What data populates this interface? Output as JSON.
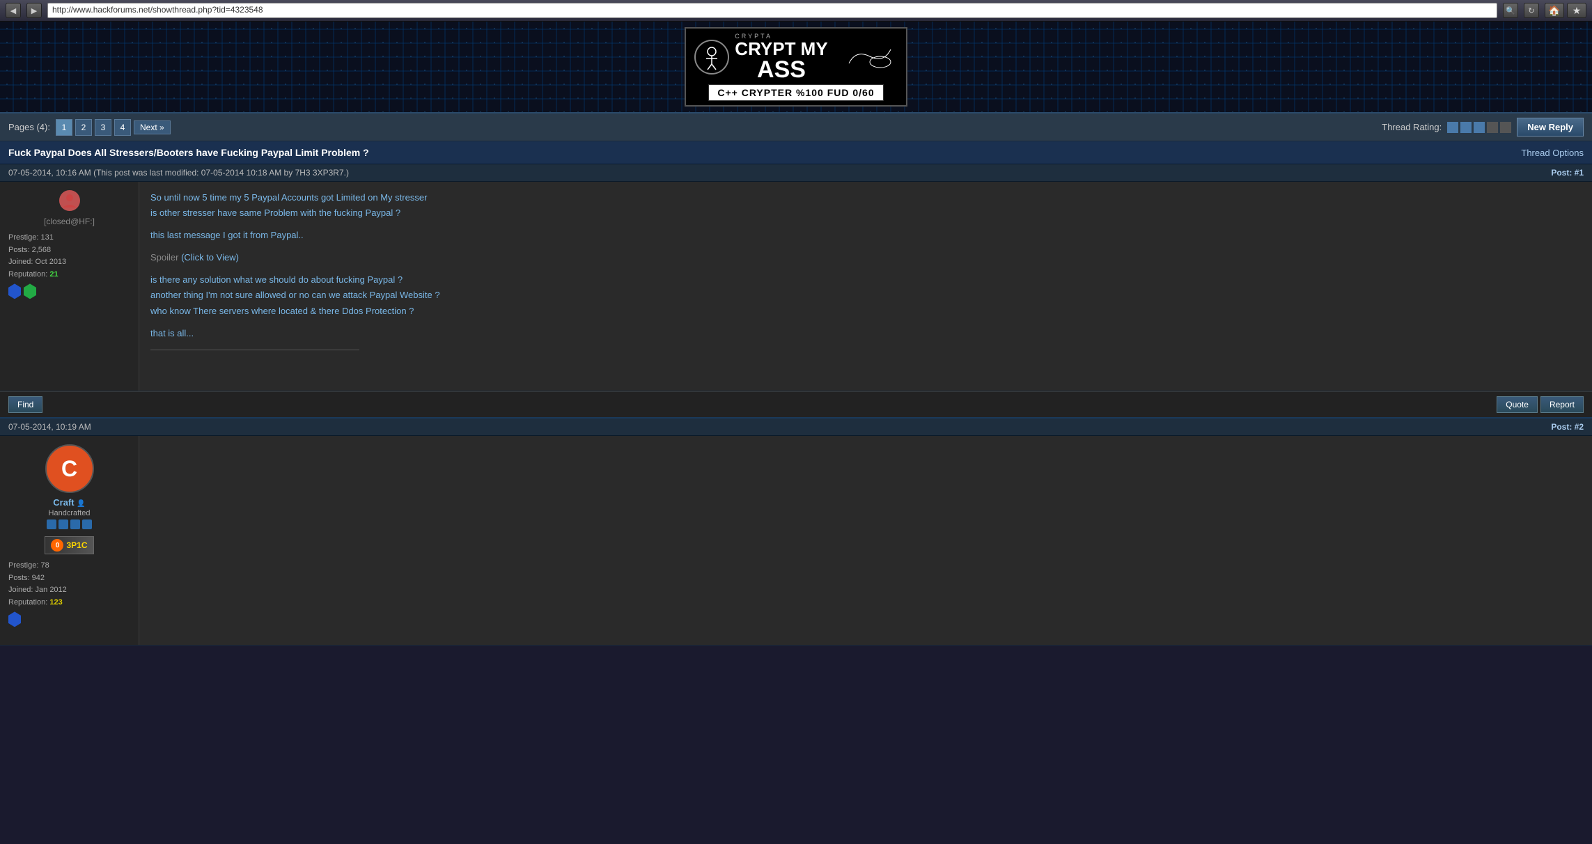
{
  "browser": {
    "url": "http://www.hackforums.net/showthread.php?tid=4323548",
    "nav_back": "◀",
    "nav_forward": "▶",
    "refresh": "↻",
    "home_icon": "🏠",
    "star_icon": "★"
  },
  "banner": {
    "crypta_text": "CRYPTA",
    "title_line1": "CRYPT MY",
    "title_line2": "ASS",
    "subtitle": "C++ CRYPTER  %100 FUD 0/60"
  },
  "pagination": {
    "label": "Pages (4):",
    "pages": [
      "1",
      "2",
      "3",
      "4"
    ],
    "next_label": "Next »",
    "active_page": "1"
  },
  "thread_rating": {
    "label": "Thread Rating:",
    "boxes": [
      "■",
      "■",
      "■",
      "□",
      "□"
    ]
  },
  "new_reply_label": "New Reply",
  "thread": {
    "title": "Fuck Paypal Does All Stressers/Booters have Fucking Paypal Limit Problem ?",
    "options_label": "Thread Options"
  },
  "posts": [
    {
      "id": "post1",
      "timestamp": "07-05-2014, 10:16 AM (This post was last modified: 07-05-2014 10:18 AM by 7H3 3XP3R7.)",
      "post_number": "Post: #1",
      "username": "[closed@HF:]",
      "avatar_type": "small_icon",
      "prestige": "Prestige: 131",
      "posts": "Posts: 2,568",
      "joined": "Joined: Oct 2013",
      "reputation_label": "Reputation:",
      "reputation_value": "21",
      "rep_color": "green",
      "content_lines": [
        "So until now 5 time my 5 Paypal Accounts got Limited on My stresser",
        "is other stresser have same Problem with the fucking Paypal ?",
        "",
        "this last message I got it from Paypal..",
        "",
        "is there any solution what we should do about fucking Paypal ?",
        "another thing I'm not sure allowed or no can we attack Paypal Website ?",
        "who know There servers where located & there Ddos Protection ?",
        "",
        "that is all..."
      ],
      "spoiler_text": "Spoiler",
      "spoiler_link": "(Click to View)",
      "find_label": "Find",
      "quote_label": "Quote",
      "report_label": "Report"
    },
    {
      "id": "post2",
      "timestamp": "07-05-2014, 10:19 AM",
      "post_number": "Post: #2",
      "username": "Craft",
      "user_icon": "👤",
      "user_title": "Handcrafted",
      "rank_dots": 4,
      "epic_badge": "3P1C",
      "prestige": "Prestige: 78",
      "posts": "Posts: 942",
      "joined": "Joined: Jan 2012",
      "reputation_label": "Reputation:",
      "reputation_value": "123",
      "rep_color": "yellow",
      "avatar_letter": "C"
    }
  ]
}
